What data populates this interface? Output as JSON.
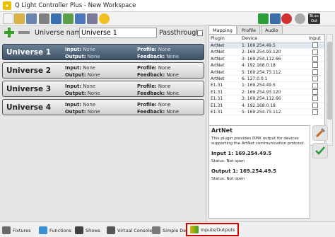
{
  "window": {
    "title": "Q Light Controller Plus - New Workspace"
  },
  "universe_panel": {
    "name_label": "Universe name:",
    "name_value": "Universe 1",
    "passthrough_label": "Passthrough",
    "universes": [
      {
        "name": "Universe 1",
        "input_label": "Input:",
        "input_value": "None",
        "output_label": "Output:",
        "output_value": "None",
        "profile_label": "Profile:",
        "profile_value": "None",
        "feedback_label": "Feedback:",
        "feedback_value": "None",
        "selected": true
      },
      {
        "name": "Universe 2",
        "input_label": "Input:",
        "input_value": "None",
        "output_label": "Output:",
        "output_value": "None",
        "profile_label": "Profile:",
        "profile_value": "None",
        "feedback_label": "Feedback:",
        "feedback_value": "None",
        "selected": false
      },
      {
        "name": "Universe 3",
        "input_label": "Input:",
        "input_value": "None",
        "output_label": "Output:",
        "output_value": "None",
        "profile_label": "Profile:",
        "profile_value": "None",
        "feedback_label": "Feedback:",
        "feedback_value": "None",
        "selected": false
      },
      {
        "name": "Universe 4",
        "input_label": "Input:",
        "input_value": "None",
        "output_label": "Output:",
        "output_value": "None",
        "profile_label": "Profile:",
        "profile_value": "None",
        "feedback_label": "Feedback:",
        "feedback_value": "None",
        "selected": false
      }
    ]
  },
  "right_panel": {
    "tabs": [
      "Mapping",
      "Profile",
      "Audio"
    ],
    "active_tab": "Mapping",
    "columns": [
      "Plugin",
      "Device",
      "Input"
    ],
    "rows": [
      {
        "plugin": "ArtNet",
        "device": "1: 169.254.49.5",
        "selected": true
      },
      {
        "plugin": "ArtNet",
        "device": "2: 169.254.93.120",
        "selected": false
      },
      {
        "plugin": "ArtNet",
        "device": "3: 169.254.112.66",
        "selected": false
      },
      {
        "plugin": "ArtNet",
        "device": "4: 192.168.0.18",
        "selected": false
      },
      {
        "plugin": "ArtNet",
        "device": "5: 169.254.73.112",
        "selected": false
      },
      {
        "plugin": "ArtNet",
        "device": "6: 127.0.0.1",
        "selected": false
      },
      {
        "plugin": "E1.31",
        "device": "1: 169.254.49.5",
        "selected": false
      },
      {
        "plugin": "E1.31",
        "device": "2: 169.254.93.120",
        "selected": false
      },
      {
        "plugin": "E1.31",
        "device": "3: 169.254.112.66",
        "selected": false
      },
      {
        "plugin": "E1.31",
        "device": "4: 192.168.0.18",
        "selected": false
      },
      {
        "plugin": "E1.31",
        "device": "5: 169.254.73.112",
        "selected": false
      }
    ],
    "info": {
      "title": "ArtNet",
      "description": "This plugin provides DMX output for devices supporting the ArtNet communication protocol.",
      "input_heading": "Input 1: 169.254.49.5",
      "input_status": "Status: Not open",
      "output_heading": "Output 1: 169.254.49.5",
      "output_status": "Status: Not open"
    }
  },
  "bottom_tabs": [
    "Fixtures",
    "Functions",
    "Shows",
    "Virtual Console",
    "Simple Desk",
    "Inputs/Outputs"
  ],
  "toolbar": {
    "blackout_label": "Bl.ao Out"
  },
  "colors": {
    "selected_universe": "#4a5d72",
    "highlight_border": "#d40000",
    "add_green": "#3aa02a"
  }
}
